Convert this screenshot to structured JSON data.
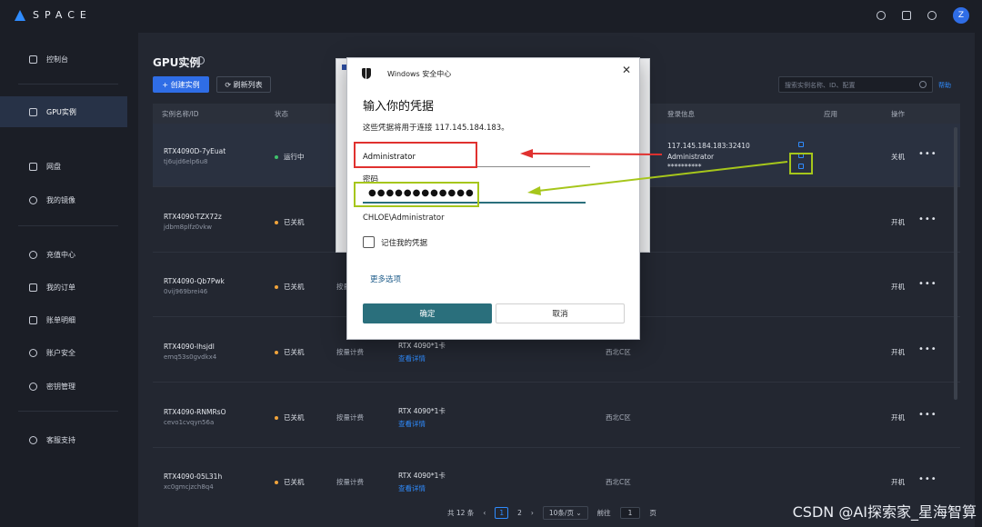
{
  "brand": {
    "logo_text": "SPACE"
  },
  "user": {
    "avatar_initial": "Z"
  },
  "sidebar": {
    "items": [
      {
        "label": "控制台"
      },
      {
        "label": "GPU实例"
      },
      {
        "label": "网盘"
      },
      {
        "label": "我的镜像"
      },
      {
        "label": "充值中心"
      },
      {
        "label": "我的订单"
      },
      {
        "label": "账单明细"
      },
      {
        "label": "账户安全"
      },
      {
        "label": "密钥管理"
      },
      {
        "label": "客服支持"
      }
    ]
  },
  "page": {
    "title": "GPU实例",
    "create_label": "+ 创建实例",
    "refresh_label": "⟳ 刷新列表",
    "search_placeholder": "搜索实例名称、ID、配置",
    "help_label": "帮助"
  },
  "table": {
    "headers": [
      "实例名称/ID",
      "状态",
      "登录信息",
      "应用",
      "操作"
    ],
    "rows": [
      {
        "name": "RTX4090D-7yEuat",
        "id": "tj6ujd6elp6u8",
        "status": "运行中",
        "billing": "",
        "spec": "",
        "spec_link": "",
        "region": "",
        "login_addr": "117.145.184.183:32410",
        "login_user": "Administrator",
        "login_pass": "**********",
        "op": "关机"
      },
      {
        "name": "RTX4090-TZX72z",
        "id": "jdbm8plfz0vkw",
        "status": "已关机",
        "billing": "",
        "spec": "",
        "spec_link": "",
        "region": "",
        "op": "开机"
      },
      {
        "name": "RTX4090-Qb7Pwk",
        "id": "0vij969brei46",
        "status": "已关机",
        "billing": "按量",
        "spec": "",
        "spec_link": "",
        "region": "",
        "op": "开机"
      },
      {
        "name": "RTX4090-lhsjdl",
        "id": "emq53s0gvdkx4",
        "status": "已关机",
        "billing": "按量计费",
        "spec": "RTX 4090*1卡",
        "spec_link": "查看详情",
        "region": "西北C区",
        "op": "开机"
      },
      {
        "name": "RTX4090-RNMRsO",
        "id": "cevo1cvqyn56a",
        "status": "已关机",
        "billing": "按量计费",
        "spec": "RTX 4090*1卡",
        "spec_link": "查看详情",
        "region": "西北C区",
        "op": "开机"
      },
      {
        "name": "RTX4090-05L31h",
        "id": "xc0gmcjzch8q4",
        "status": "已关机",
        "billing": "按量计费",
        "spec": "RTX 4090*1卡",
        "spec_link": "查看详情",
        "region": "西北C区",
        "op": "开机"
      }
    ]
  },
  "pager": {
    "total": "共 12 条",
    "prev": "‹",
    "page1": "1",
    "page2": "2",
    "next": "›",
    "size": "10条/页 ⌄",
    "goto": "前往",
    "goto_value": "1",
    "page_unit": "页"
  },
  "dialog": {
    "title": "Windows 安全中心",
    "close": "✕",
    "heading": "输入你的凭据",
    "description": "这些凭据将用于连接 117.145.184.183。",
    "username": "Administrator",
    "password_label": "密码",
    "password_masked": "●●●●●●●●●●●●",
    "account": "CHLOE\\Administrator",
    "remember_label": "记住我的凭据",
    "more_options": "更多选项",
    "ok_label": "确定",
    "cancel_label": "取消"
  },
  "watermark": "CSDN @AI探索家_星海智算",
  "colors": {
    "accent": "#2f6de6",
    "dialog_primary": "#2a6f7c",
    "annotation_red": "#e0312f",
    "annotation_green": "#a6c61b"
  }
}
